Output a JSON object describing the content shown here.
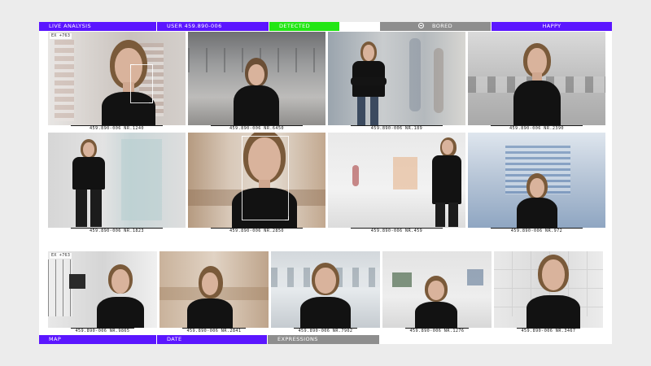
{
  "top_bar": {
    "live_analysis": "LIVE ANALYSIS",
    "user": "USER 459.890-006",
    "status": "DETECTED",
    "mood_bored": "BORED",
    "mood_happy": "HAPPY"
  },
  "bottom_bar": {
    "map": "MAP",
    "date": "DATE",
    "expressions": "EXPRESSIONS"
  },
  "tags": {
    "first": "EX +763",
    "bottom_first": "EX +763"
  },
  "captions": {
    "r1c1": "459.890-006 NR.1240",
    "r1c2": "459.890-006 NR.6450",
    "r1c3": "459.890-006 NR.189",
    "r1c4": "459.890-006 NR.2390",
    "r2c1": "459.890-006 NR.1823",
    "r2c2": "459.890-006 NR.2850",
    "r2c3": "459.890-006 NR.459",
    "r2c4": "459.890-006 NR.972",
    "r3c1": "459.890-006 NR.9865",
    "r3c2": "459.890-006 NR.2841",
    "r3c3": "459.890-006 NR.7902",
    "r3c4": "459.890-006 NR.1276",
    "r3c5": "459.890-006 NR.3467"
  },
  "colors": {
    "accent_purple": "#5b16ff",
    "status_green": "#22e614",
    "neutral_gray": "#8e8e8e"
  }
}
